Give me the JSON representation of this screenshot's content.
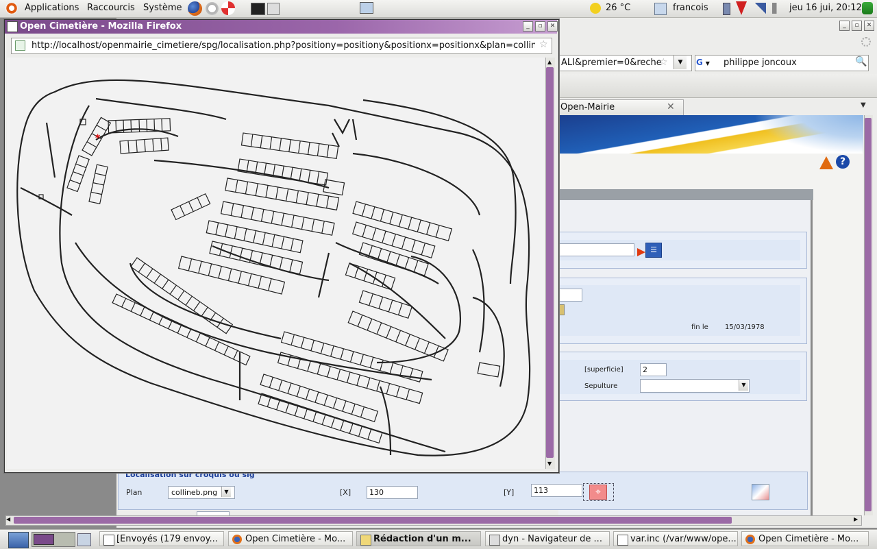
{
  "top_panel": {
    "menus": [
      "Applications",
      "Raccourcis",
      "Système"
    ],
    "weather": "26 °C",
    "user": "francois",
    "datetime": "jeu 16 jui, 20:12"
  },
  "background_window": {
    "url_tail": "ALI&premier=0&reche",
    "search_engine": "G",
    "search_value": "philippe joncoux",
    "tab_label": "Open-Mairie",
    "form": {
      "fin_label": "fin le",
      "fin_value": "15/03/1978",
      "superficie_label": "[superficie]",
      "superficie_value": "2",
      "sepulture_label": "Sepulture",
      "loc_title": "Localisation sur croquis ou sig",
      "plan_label": "Plan",
      "plan_value": "collineb.png",
      "x_label": "[X]",
      "x_value": "130",
      "y_label": "[Y]",
      "y_value": "113"
    }
  },
  "popup": {
    "title": "Open Cimetière - Mozilla Firefox",
    "url": "http://localhost/openmairie_cimetiere/spg/localisation.php?positiony=positiony&positionx=positionx&plan=collineb",
    "marker": "*"
  },
  "taskbar": {
    "items": [
      {
        "label": "[Envoyés (179 envoy...",
        "active": false
      },
      {
        "label": "Open Cimetière - Mo...",
        "active": false
      },
      {
        "label": "Rédaction d'un m...",
        "active": true
      },
      {
        "label": "dyn - Navigateur de ...",
        "active": false
      },
      {
        "label": "var.inc (/var/www/ope...",
        "active": false
      },
      {
        "label": "Open Cimetière - Mo...",
        "active": false
      }
    ]
  }
}
